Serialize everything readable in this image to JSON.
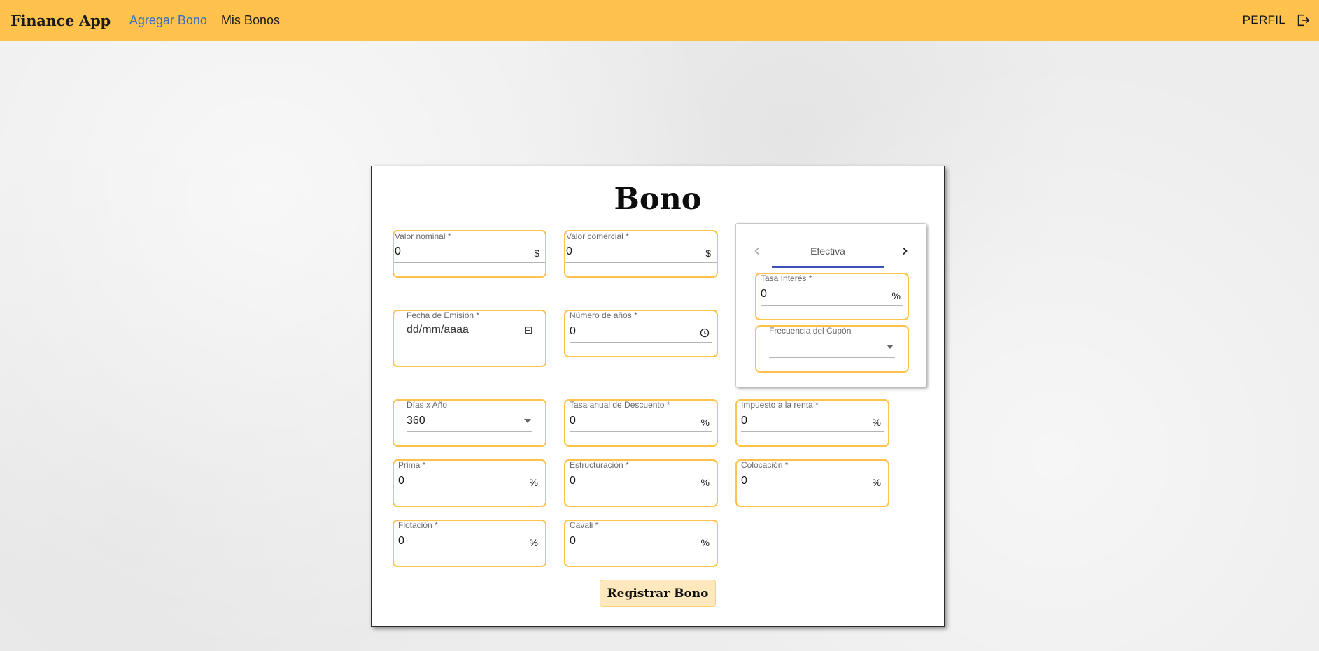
{
  "app": {
    "brand": "Finance App",
    "nav": [
      {
        "label": "Agregar Bono",
        "active": true
      },
      {
        "label": "Mis Bonos",
        "active": false
      }
    ],
    "profile_label": "PERFIL",
    "logout_icon": "logout-icon",
    "accent_color": "#ffc24d",
    "active_link_color": "#3a6fc4"
  },
  "form": {
    "title": "Bono",
    "valor_nominal": {
      "label": "Valor nominal *",
      "value": "0",
      "adornment": "$"
    },
    "valor_comercial": {
      "label": "Valor comercial *",
      "value": "0",
      "adornment": "$"
    },
    "fecha_emision": {
      "label": "Fecha de Emisión *",
      "placeholder": "dd/mm/aaaa",
      "icon": "calendar-icon"
    },
    "numero_anios": {
      "label": "Número de años *",
      "value": "0",
      "icon": "clock-icon"
    },
    "tasa": {
      "tab_label": "Efectiva",
      "tab_ink_color": "#3f51b5",
      "tasa_interes": {
        "label": "Tasa Interés *",
        "value": "0",
        "adornment": "%"
      },
      "frecuencia_cupon": {
        "label": "Frecuencia del Cupón",
        "value": ""
      }
    },
    "dias_anio": {
      "label": "Días x Año",
      "value": "360"
    },
    "tasa_descuento": {
      "label": "Tasa anual de Descuento *",
      "value": "0",
      "adornment": "%"
    },
    "impuesto_renta": {
      "label": "Impuesto a la renta *",
      "value": "0",
      "adornment": "%"
    },
    "prima": {
      "label": "Prima *",
      "value": "0",
      "adornment": "%"
    },
    "estructuracion": {
      "label": "Estructuración *",
      "value": "0",
      "adornment": "%"
    },
    "colocacion": {
      "label": "Colocación *",
      "value": "0",
      "adornment": "%"
    },
    "flotacion": {
      "label": "Flotación *",
      "value": "0",
      "adornment": "%"
    },
    "cavali": {
      "label": "Cavali *",
      "value": "0",
      "adornment": "%"
    },
    "submit_label": "Registrar Bono"
  }
}
